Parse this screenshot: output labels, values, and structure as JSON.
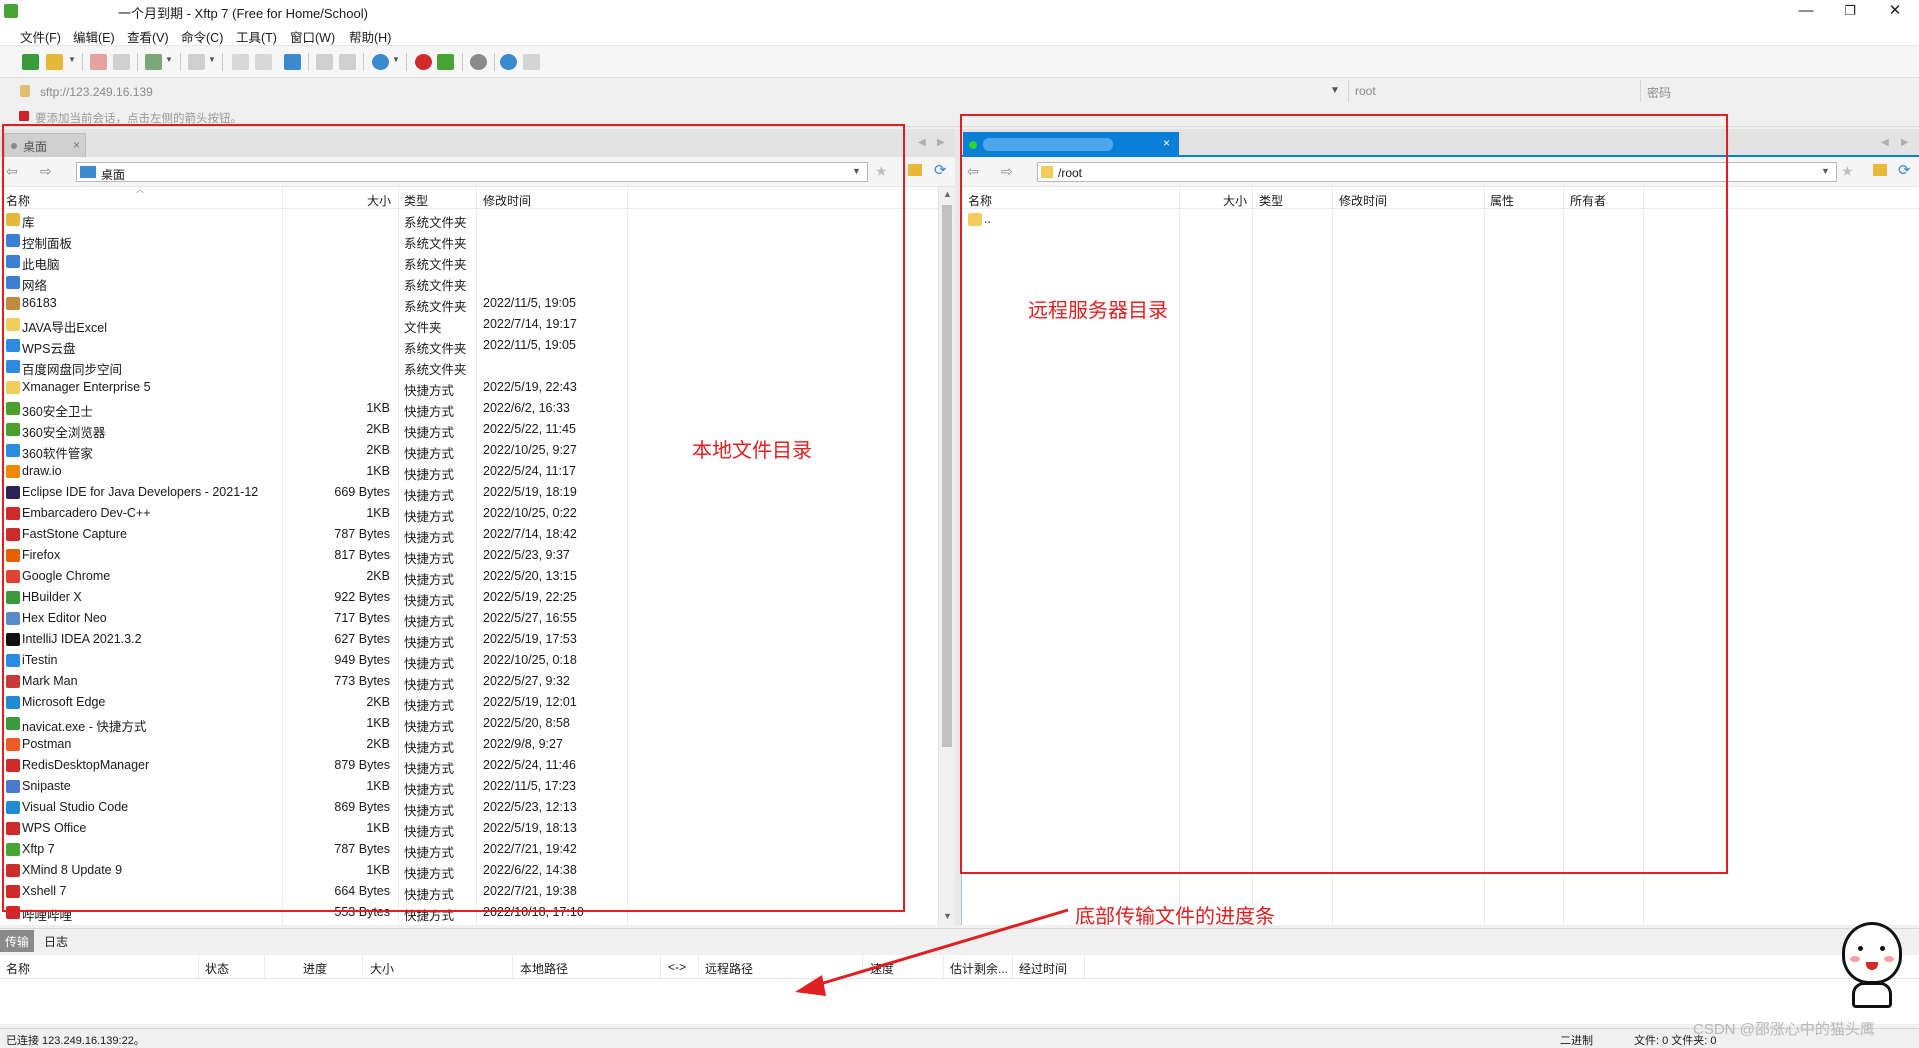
{
  "window": {
    "title": "一个月到期 - Xftp 7 (Free for Home/School)",
    "minimize": "—",
    "maximize": "❐",
    "close": "✕"
  },
  "menu": [
    "文件(F)",
    "编辑(E)",
    "查看(V)",
    "命令(C)",
    "工具(T)",
    "窗口(W)",
    "帮助(H)"
  ],
  "address": {
    "url": "sftp://123.249.16.139",
    "user_placeholder": "root",
    "password_placeholder": "密码"
  },
  "hint": "要添加当前会话，点击左侧的箭头按钮。",
  "left": {
    "tab": "桌面",
    "tab_close": "×",
    "path": "桌面",
    "columns": [
      "名称",
      "大小",
      "类型",
      "修改时间"
    ],
    "rows": [
      {
        "name": "库",
        "size": "",
        "type": "系统文件夹",
        "date": "",
        "icon": "library-icon",
        "color": "#e8b83a"
      },
      {
        "name": "控制面板",
        "size": "",
        "type": "系统文件夹",
        "date": "",
        "icon": "control-panel-icon",
        "color": "#3b7fd4"
      },
      {
        "name": "此电脑",
        "size": "",
        "type": "系统文件夹",
        "date": "",
        "icon": "computer-icon",
        "color": "#3b7fd4"
      },
      {
        "name": "网络",
        "size": "",
        "type": "系统文件夹",
        "date": "",
        "icon": "network-icon",
        "color": "#3b7fd4"
      },
      {
        "name": "86183",
        "size": "",
        "type": "系统文件夹",
        "date": "2022/11/5, 19:05",
        "icon": "user-folder-icon",
        "color": "#c28a3c"
      },
      {
        "name": "JAVA导出Excel",
        "size": "",
        "type": "文件夹",
        "date": "2022/7/14, 19:17",
        "icon": "folder-icon",
        "color": "#f2cd5c"
      },
      {
        "name": "WPS云盘",
        "size": "",
        "type": "系统文件夹",
        "date": "2022/11/5, 19:05",
        "icon": "cloud-icon",
        "color": "#2a8be0"
      },
      {
        "name": "百度网盘同步空间",
        "size": "",
        "type": "系统文件夹",
        "date": "",
        "icon": "cloud-sync-icon",
        "color": "#2a8be0"
      },
      {
        "name": "Xmanager Enterprise 5",
        "size": "",
        "type": "快捷方式",
        "date": "2022/5/19, 22:43",
        "icon": "shortcut-icon",
        "color": "#f2cd5c"
      },
      {
        "name": "360安全卫士",
        "size": "1KB",
        "type": "快捷方式",
        "date": "2022/6/2, 16:33",
        "icon": "360-icon",
        "color": "#4aa02c"
      },
      {
        "name": "360安全浏览器",
        "size": "2KB",
        "type": "快捷方式",
        "date": "2022/5/22, 11:45",
        "icon": "360-browser-icon",
        "color": "#4aa02c"
      },
      {
        "name": "360软件管家",
        "size": "2KB",
        "type": "快捷方式",
        "date": "2022/10/25, 9:27",
        "icon": "360-manager-icon",
        "color": "#2a8be0"
      },
      {
        "name": "draw.io",
        "size": "1KB",
        "type": "快捷方式",
        "date": "2022/5/24, 11:17",
        "icon": "drawio-icon",
        "color": "#f08705"
      },
      {
        "name": "Eclipse IDE for Java Developers - 2021-12",
        "size": "669 Bytes",
        "type": "快捷方式",
        "date": "2022/5/19, 18:19",
        "icon": "eclipse-icon",
        "color": "#2c2255"
      },
      {
        "name": "Embarcadero Dev-C++",
        "size": "1KB",
        "type": "快捷方式",
        "date": "2022/10/25, 0:22",
        "icon": "devcpp-icon",
        "color": "#d02a2a"
      },
      {
        "name": "FastStone Capture",
        "size": "787 Bytes",
        "type": "快捷方式",
        "date": "2022/7/14, 18:42",
        "icon": "faststone-icon",
        "color": "#d02a2a"
      },
      {
        "name": "Firefox",
        "size": "817 Bytes",
        "type": "快捷方式",
        "date": "2022/5/23, 9:37",
        "icon": "firefox-icon",
        "color": "#e66000"
      },
      {
        "name": "Google Chrome",
        "size": "2KB",
        "type": "快捷方式",
        "date": "2022/5/20, 13:15",
        "icon": "chrome-icon",
        "color": "#e34133"
      },
      {
        "name": "HBuilder X",
        "size": "922 Bytes",
        "type": "快捷方式",
        "date": "2022/5/19, 22:25",
        "icon": "hbuilder-icon",
        "color": "#3a9b3a"
      },
      {
        "name": "Hex Editor Neo",
        "size": "717 Bytes",
        "type": "快捷方式",
        "date": "2022/5/27, 16:55",
        "icon": "hex-editor-icon",
        "color": "#5a8ac8"
      },
      {
        "name": "IntelliJ IDEA 2021.3.2",
        "size": "627 Bytes",
        "type": "快捷方式",
        "date": "2022/5/19, 17:53",
        "icon": "intellij-icon",
        "color": "#111111"
      },
      {
        "name": "iTestin",
        "size": "949 Bytes",
        "type": "快捷方式",
        "date": "2022/10/25, 0:18",
        "icon": "itestin-icon",
        "color": "#2a8be0"
      },
      {
        "name": "Mark Man",
        "size": "773 Bytes",
        "type": "快捷方式",
        "date": "2022/5/27, 9:32",
        "icon": "markman-icon",
        "color": "#c83a3a"
      },
      {
        "name": "Microsoft Edge",
        "size": "2KB",
        "type": "快捷方式",
        "date": "2022/5/19, 12:01",
        "icon": "edge-icon",
        "color": "#1f8bd0"
      },
      {
        "name": "navicat.exe - 快捷方式",
        "size": "1KB",
        "type": "快捷方式",
        "date": "2022/5/20, 8:58",
        "icon": "navicat-icon",
        "color": "#3a9b3a"
      },
      {
        "name": "Postman",
        "size": "2KB",
        "type": "快捷方式",
        "date": "2022/9/8, 9:27",
        "icon": "postman-icon",
        "color": "#ef5b25"
      },
      {
        "name": "RedisDesktopManager",
        "size": "879 Bytes",
        "type": "快捷方式",
        "date": "2022/5/24, 11:46",
        "icon": "redis-icon",
        "color": "#d02a2a"
      },
      {
        "name": "Snipaste",
        "size": "1KB",
        "type": "快捷方式",
        "date": "2022/11/5, 17:23",
        "icon": "snipaste-icon",
        "color": "#4a7ad0"
      },
      {
        "name": "Visual Studio Code",
        "size": "869 Bytes",
        "type": "快捷方式",
        "date": "2022/5/23, 12:13",
        "icon": "vscode-icon",
        "color": "#1f8bd0"
      },
      {
        "name": "WPS Office",
        "size": "1KB",
        "type": "快捷方式",
        "date": "2022/5/19, 18:13",
        "icon": "wps-icon",
        "color": "#d02a2a"
      },
      {
        "name": "Xftp 7",
        "size": "787 Bytes",
        "type": "快捷方式",
        "date": "2022/7/21, 19:42",
        "icon": "xftp-icon",
        "color": "#46a534"
      },
      {
        "name": "XMind 8 Update 9",
        "size": "1KB",
        "type": "快捷方式",
        "date": "2022/6/22, 14:38",
        "icon": "xmind-icon",
        "color": "#d02a2a"
      },
      {
        "name": "Xshell 7",
        "size": "664 Bytes",
        "type": "快捷方式",
        "date": "2022/7/21, 19:38",
        "icon": "xshell-icon",
        "color": "#d02a2a"
      },
      {
        "name": "哔哩哔哩",
        "size": "553 Bytes",
        "type": "快捷方式",
        "date": "2022/10/18, 17:10",
        "icon": "bilibili-icon",
        "color": "#d02a2a"
      }
    ]
  },
  "right": {
    "path": "/root",
    "columns": [
      "名称",
      "大小",
      "类型",
      "修改时间",
      "属性",
      "所有者"
    ],
    "rows": [
      {
        "name": "..",
        "icon": "parent-folder-icon",
        "color": "#f2cd5c"
      }
    ]
  },
  "annotations": {
    "local": "本地文件目录",
    "remote": "远程服务器目录",
    "progress": "底部传输文件的进度条",
    "arrow_color": "#e02020"
  },
  "bottom": {
    "tabs": [
      "传输",
      "日志"
    ],
    "columns": [
      "名称",
      "状态",
      "进度",
      "大小",
      "本地路径",
      "<->",
      "远程路径",
      "速度",
      "估计剩余...",
      "经过时间"
    ]
  },
  "status": {
    "connected": "已连接 123.249.16.139:22。",
    "mode": "二进制",
    "files": "文件: 0  文件夹: 0"
  },
  "watermark": "CSDN @邵涨心中的猫头鹰"
}
